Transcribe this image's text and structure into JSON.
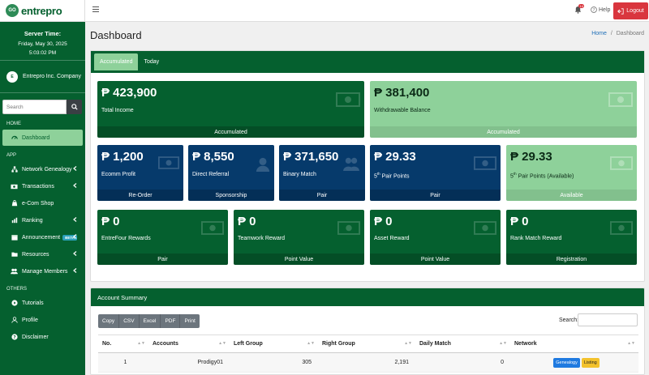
{
  "brand": {
    "name": "entrepro",
    "logo_text": "GO"
  },
  "server": {
    "title": "Server Time:",
    "date": "Friday, May 30, 2025",
    "time": "5:03:02 PM"
  },
  "company": {
    "name": "Entrepro Inc. Company",
    "avatar_text": "E"
  },
  "search": {
    "placeholder": "Search"
  },
  "sidebar": {
    "home_header": "HOME",
    "app_header": "APP",
    "others_header": "OTHERS",
    "items": [
      {
        "label": "Dashboard",
        "icon": "dashboard-icon"
      },
      {
        "label": "Network Genealogy",
        "icon": "network-icon"
      },
      {
        "label": "Transactions",
        "icon": "money-icon"
      },
      {
        "label": "e-Com Shop",
        "icon": "shop-icon"
      },
      {
        "label": "Ranking",
        "icon": "chart-icon"
      },
      {
        "label": "Announcement",
        "icon": "calendar-icon",
        "badge": "BETA"
      },
      {
        "label": "Resources",
        "icon": "folder-icon"
      },
      {
        "label": "Manage Members",
        "icon": "users-icon"
      },
      {
        "label": "Tutorials",
        "icon": "play-icon"
      },
      {
        "label": "Profile",
        "icon": "user-icon"
      },
      {
        "label": "Disclaimer",
        "icon": "question-icon"
      }
    ]
  },
  "topbar": {
    "notif_count": "14",
    "help_label": "Help",
    "logout_label": "Logout"
  },
  "page": {
    "title": "Dashboard",
    "crumb_home": "Home",
    "crumb_sep": "/",
    "crumb_current": "Dashboard"
  },
  "tabs": [
    "Accumulated",
    "Today"
  ],
  "cards": {
    "total_income": {
      "value": "₱ 423,900",
      "label": "Total Income",
      "footer": "Accumulated"
    },
    "withdrawable": {
      "value": "₱ 381,400",
      "label": "Withdrawable Balance",
      "footer": "Accumulated"
    },
    "ecomm": {
      "value": "₱ 1,200",
      "label": "Ecomm Profit",
      "footer": "Re-Order"
    },
    "direct": {
      "value": "₱ 8,550",
      "label": "Direct Referral",
      "footer": "Sponsorship"
    },
    "binary": {
      "value": "₱ 371,650",
      "label": "Binary Match",
      "footer": "Pair"
    },
    "fifth_pair": {
      "value": "₱ 29.33",
      "label_sup": "th",
      "label_pre": "5",
      "label_post": " Pair Points",
      "footer": "Pair"
    },
    "fifth_pair_avail": {
      "value": "₱ 29.33",
      "label_sup": "th",
      "label_pre": "5",
      "label_post": " Pair Points (Available)",
      "footer": "Available"
    },
    "entrefour": {
      "value": "₱ 0",
      "label": "EntreFour Rewards",
      "footer": "Pair"
    },
    "teamwork": {
      "value": "₱ 0",
      "label": "Teamwork Reward",
      "footer": "Point Value"
    },
    "asset": {
      "value": "₱ 0",
      "label": "Asset Reward",
      "footer": "Point Value"
    },
    "rank_match": {
      "value": "₱ 0",
      "label": "Rank Match Reward",
      "footer": "Registration"
    }
  },
  "summary": {
    "title": "Account Summary",
    "buttons": [
      "Copy",
      "CSV",
      "Excel",
      "PDF",
      "Print"
    ],
    "search_label": "Search:",
    "columns": [
      "No.",
      "Accounts",
      "Left Group",
      "Right Group",
      "Daily Match",
      "Network"
    ],
    "rows": [
      {
        "no": "1",
        "account": "Prodigy01",
        "left": "305",
        "right": "2,191",
        "daily": "0",
        "b1": "Genealogy",
        "b2": "Listing"
      }
    ]
  },
  "colors": {
    "primary": "#05602f",
    "light": "#8ed19a",
    "navy": "#063a6b",
    "danger": "#d9363e"
  }
}
